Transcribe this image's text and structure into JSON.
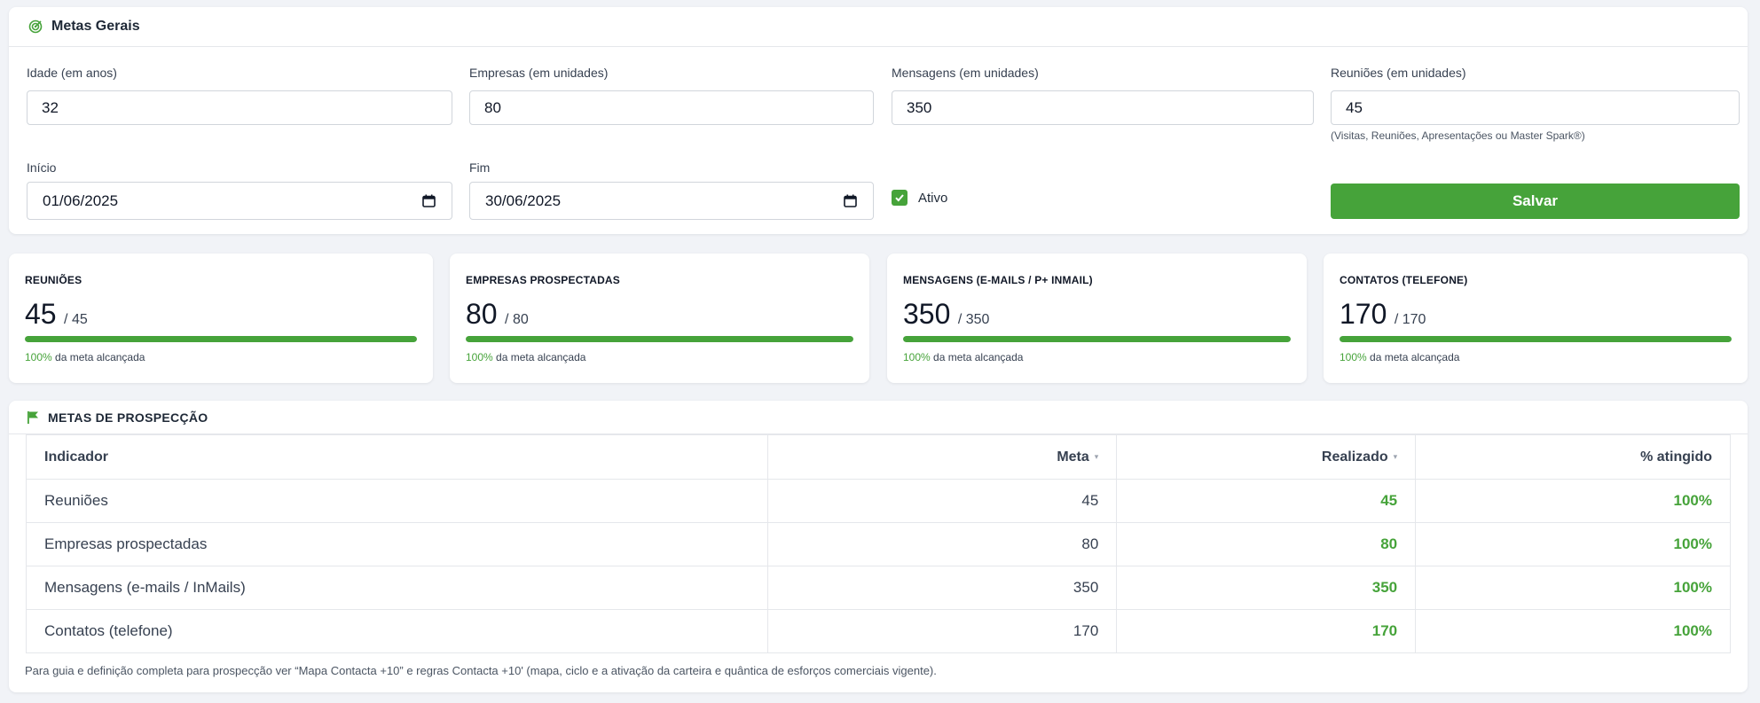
{
  "general": {
    "title": "Metas Gerais",
    "fields": {
      "idade": {
        "label": "Idade (em anos)",
        "value": "32"
      },
      "empresas": {
        "label": "Empresas (em unidades)",
        "value": "80"
      },
      "mensagens": {
        "label": "Mensagens (em unidades)",
        "value": "350"
      },
      "reunioes": {
        "label": "Reuniões (em unidades)",
        "value": "45",
        "helper": "(Visitas, Reuniões, Apresentações ou Master Spark®)"
      },
      "inicio": {
        "label": "Início",
        "value": "01/06/2025"
      },
      "fim": {
        "label": "Fim",
        "value": "30/06/2025"
      }
    },
    "ativo": {
      "label": "Ativo",
      "checked": true
    },
    "save_label": "Salvar"
  },
  "kpis": [
    {
      "title": "REUNIÕES",
      "value": "45",
      "target": "/ 45",
      "progress": 100,
      "percent_text": "100%",
      "caption": "da meta alcançada"
    },
    {
      "title": "EMPRESAS PROSPECTADAS",
      "value": "80",
      "target": "/ 80",
      "progress": 100,
      "percent_text": "100%",
      "caption": "da meta alcançada"
    },
    {
      "title": "MENSAGENS (E-MAILS / P+ INMAIL)",
      "value": "350",
      "target": "/ 350",
      "progress": 100,
      "percent_text": "100%",
      "caption": "da meta alcançada"
    },
    {
      "title": "CONTATOS (TELEFONE)",
      "value": "170",
      "target": "/ 170",
      "progress": 100,
      "percent_text": "100%",
      "caption": "da meta alcançada"
    }
  ],
  "prospect": {
    "title": "METAS DE PROSPECÇÃO",
    "columns": {
      "indicador": "Indicador",
      "meta": "Meta",
      "realizado": "Realizado",
      "atingido": "% atingido"
    },
    "rows": [
      {
        "indicador": "Reuniões",
        "meta": "45",
        "realizado": "45",
        "atingido": "100%"
      },
      {
        "indicador": "Empresas prospectadas",
        "meta": "80",
        "realizado": "80",
        "atingido": "100%"
      },
      {
        "indicador": "Mensagens (e-mails / InMails)",
        "meta": "350",
        "realizado": "350",
        "atingido": "100%"
      },
      {
        "indicador": "Contatos (telefone)",
        "meta": "170",
        "realizado": "170",
        "atingido": "100%"
      }
    ],
    "footnote": "Para guia e definição completa para prospecção ver “Mapa Contacta +10” e regras Contacta +10' (mapa, ciclo e a ativação da carteira e quântica de esforços comerciais vigente)."
  },
  "colors": {
    "accent": "#46a33a",
    "background": "#f1f3f7",
    "border": "#e5e7eb"
  },
  "icons": {
    "general": "target-icon",
    "prospect": "flag-icon",
    "date": "calendar-icon",
    "sort": "sort-caret-icon"
  }
}
